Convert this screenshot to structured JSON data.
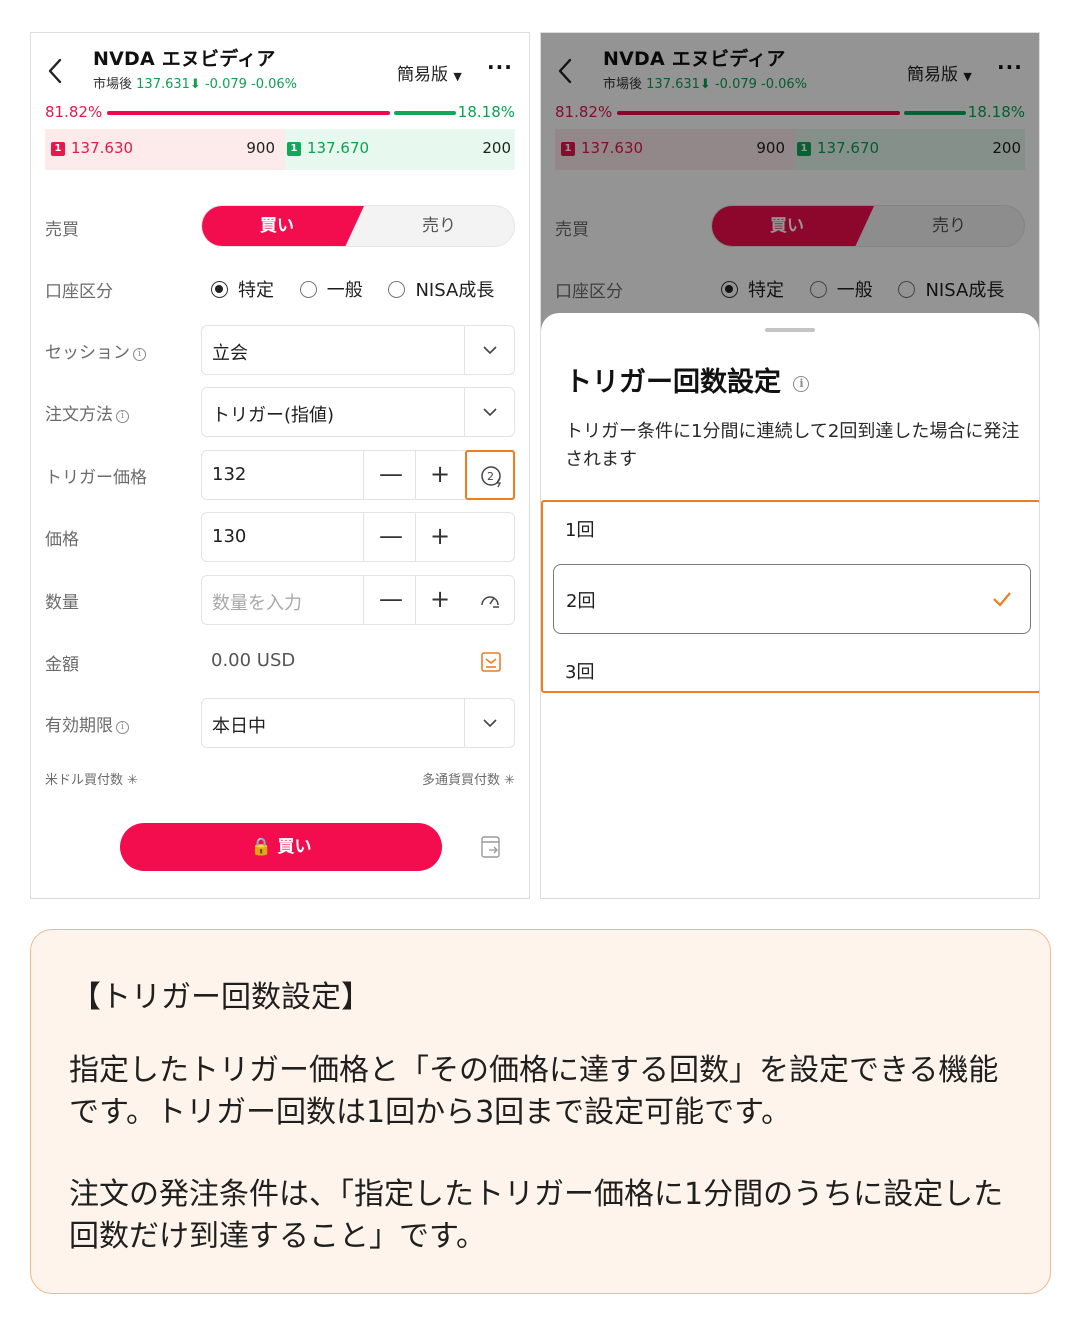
{
  "header": {
    "title": "NVDA エヌビディア",
    "session_label": "市場後",
    "price": "137.631",
    "change": "-0.079",
    "change_pct": "-0.06%",
    "mode_label": "簡易版",
    "more_label": "···"
  },
  "depth": {
    "bid_ratio": "81.82%",
    "ask_ratio": "18.18%",
    "bid_ratio_value": 81.82,
    "bid_price": "137.630",
    "bid_size": "900",
    "ask_price": "137.670",
    "ask_size": "200",
    "level": "1"
  },
  "form": {
    "side_label": "売買",
    "buy_label": "買い",
    "sell_label": "売り",
    "account_label": "口座区分",
    "account_options": [
      "特定",
      "一般",
      "NISA成長"
    ],
    "account_selected": "特定",
    "session_label": "セッション",
    "session_value": "立会",
    "order_type_label": "注文方法",
    "order_type_value": "トリガー(指値)",
    "trigger_price_label": "トリガー価格",
    "trigger_price_value": "132",
    "price_label": "価格",
    "price_value": "130",
    "qty_label": "数量",
    "qty_placeholder": "数量を入力",
    "amount_label": "金額",
    "amount_value": "0.00 USD",
    "expiry_label": "有効期限",
    "expiry_value": "本日中",
    "usd_buying_power": "米ドル買付数",
    "multi_buying_power": "多通貨買付数",
    "submit_label": "買い"
  },
  "sheet": {
    "title": "トリガー回数設定",
    "description": "トリガー条件に1分間に連続して2回到達した場合に発注されます",
    "options": [
      "1回",
      "2回",
      "3回"
    ],
    "selected": "2回"
  },
  "note": {
    "title": "【トリガー回数設定】",
    "p1": "指定したトリガー価格と「その価格に達する回数」を設定できる機能です。トリガー回数は1回から3回まで設定可能です。",
    "p2": "注文の発注条件は、「指定したトリガー価格に1分間のうちに設定した回数だけ到達すること」です。"
  },
  "colors": {
    "buy": "#f30d4f",
    "up_green": "#11a859",
    "highlight": "#f07d22",
    "note_bg": "#fef4ec"
  }
}
